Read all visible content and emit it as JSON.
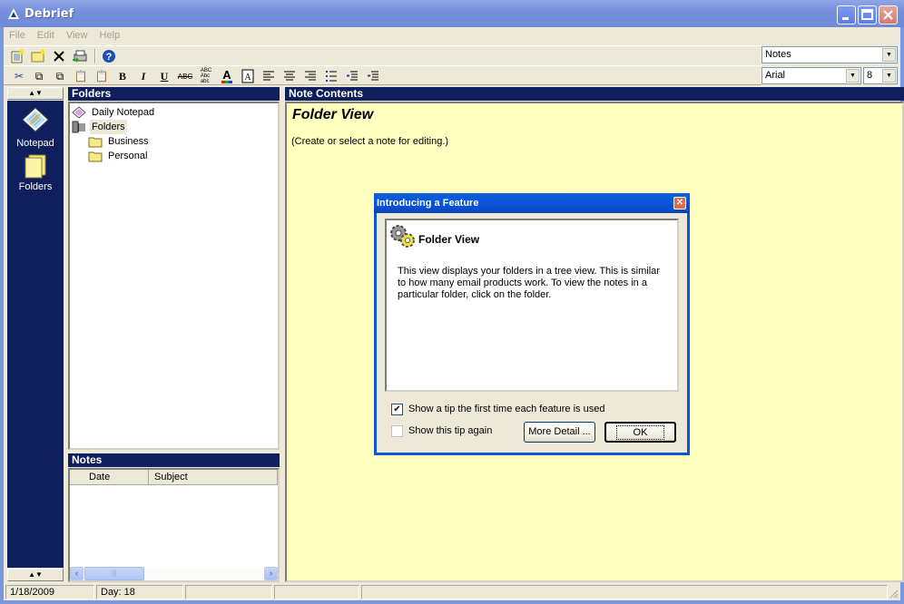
{
  "window": {
    "title": "Debrief",
    "app_icon": "debrief-logo-icon"
  },
  "menu": [
    "File",
    "Edit",
    "View",
    "Help"
  ],
  "toolbar1": {
    "buttons": [
      "new-note-icon",
      "new-folder-icon",
      "delete-icon",
      "print-icon",
      "help-icon"
    ]
  },
  "toolbar2": {
    "buttons": [
      "cut-icon",
      "copy-icon",
      "copy-format-icon",
      "paste-icon",
      "paste-special-icon",
      "bold-icon",
      "italic-icon",
      "underline-icon",
      "strikethrough-icon",
      "spellcheck-icon",
      "font-color-icon",
      "text-box-icon",
      "align-left-icon",
      "align-center-icon",
      "align-right-icon",
      "bullets-icon",
      "decrease-indent-icon",
      "increase-indent-icon"
    ]
  },
  "combos": {
    "view": "Notes",
    "font": "Arial",
    "size": "8"
  },
  "leftbar": {
    "items": [
      {
        "label": "Notepad",
        "icon": "notepad-icon"
      },
      {
        "label": "Folders",
        "icon": "folders-icon"
      }
    ]
  },
  "folders_panel": {
    "header": "Folders",
    "tree": [
      {
        "label": "Daily Notepad",
        "level": 0,
        "icon": "notepad-icon"
      },
      {
        "label": "Folders",
        "level": 0,
        "icon": "folders-root-icon",
        "selected": true
      },
      {
        "label": "Business",
        "level": 1,
        "icon": "folder-icon"
      },
      {
        "label": "Personal",
        "level": 1,
        "icon": "folder-icon"
      }
    ]
  },
  "notes_panel": {
    "header": "Notes",
    "columns": [
      "Date",
      "Subject"
    ],
    "rows": []
  },
  "content_panel": {
    "header": "Note Contents",
    "title": "Folder View",
    "hint": "(Create or select a note for editing.)"
  },
  "statusbar": {
    "date": "1/18/2009",
    "day": "Day:  18",
    "pane3": "",
    "pane4": ""
  },
  "dialog": {
    "title": "Introducing a Feature",
    "heading": "Folder View",
    "text": "This view displays your folders in a tree view. This is similar to how many email products work. To view the notes in a particular folder, click on the folder.",
    "checkbox1": {
      "label": "Show a tip the first time each feature is used",
      "checked": true
    },
    "checkbox2": {
      "label": "Show this tip again",
      "checked": false
    },
    "more_detail": "More Detail ...",
    "ok": "OK"
  }
}
